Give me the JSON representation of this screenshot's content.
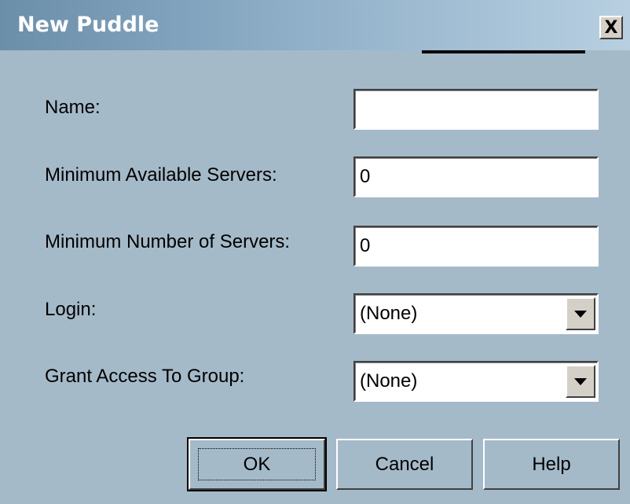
{
  "window": {
    "title": "New Puddle",
    "close_glyph": "X"
  },
  "form": {
    "name": {
      "label": "Name:",
      "value": ""
    },
    "min_available_servers": {
      "label": "Minimum Available Servers:",
      "value": "0"
    },
    "min_number_servers": {
      "label": "Minimum Number of Servers:",
      "value": "0"
    },
    "login": {
      "label": "Login:",
      "selected": "(None)"
    },
    "grant_access_group": {
      "label": "Grant Access To Group:",
      "selected": "(None)"
    }
  },
  "buttons": {
    "ok": "OK",
    "cancel": "Cancel",
    "help": "Help"
  },
  "icons": {
    "close": "close-icon",
    "dropdown": "chevron-down-icon"
  },
  "colors": {
    "dialog_bg": "#a5bac9",
    "title_gradient_start": "#6b8ea9",
    "title_gradient_end": "#b7cfe1"
  }
}
